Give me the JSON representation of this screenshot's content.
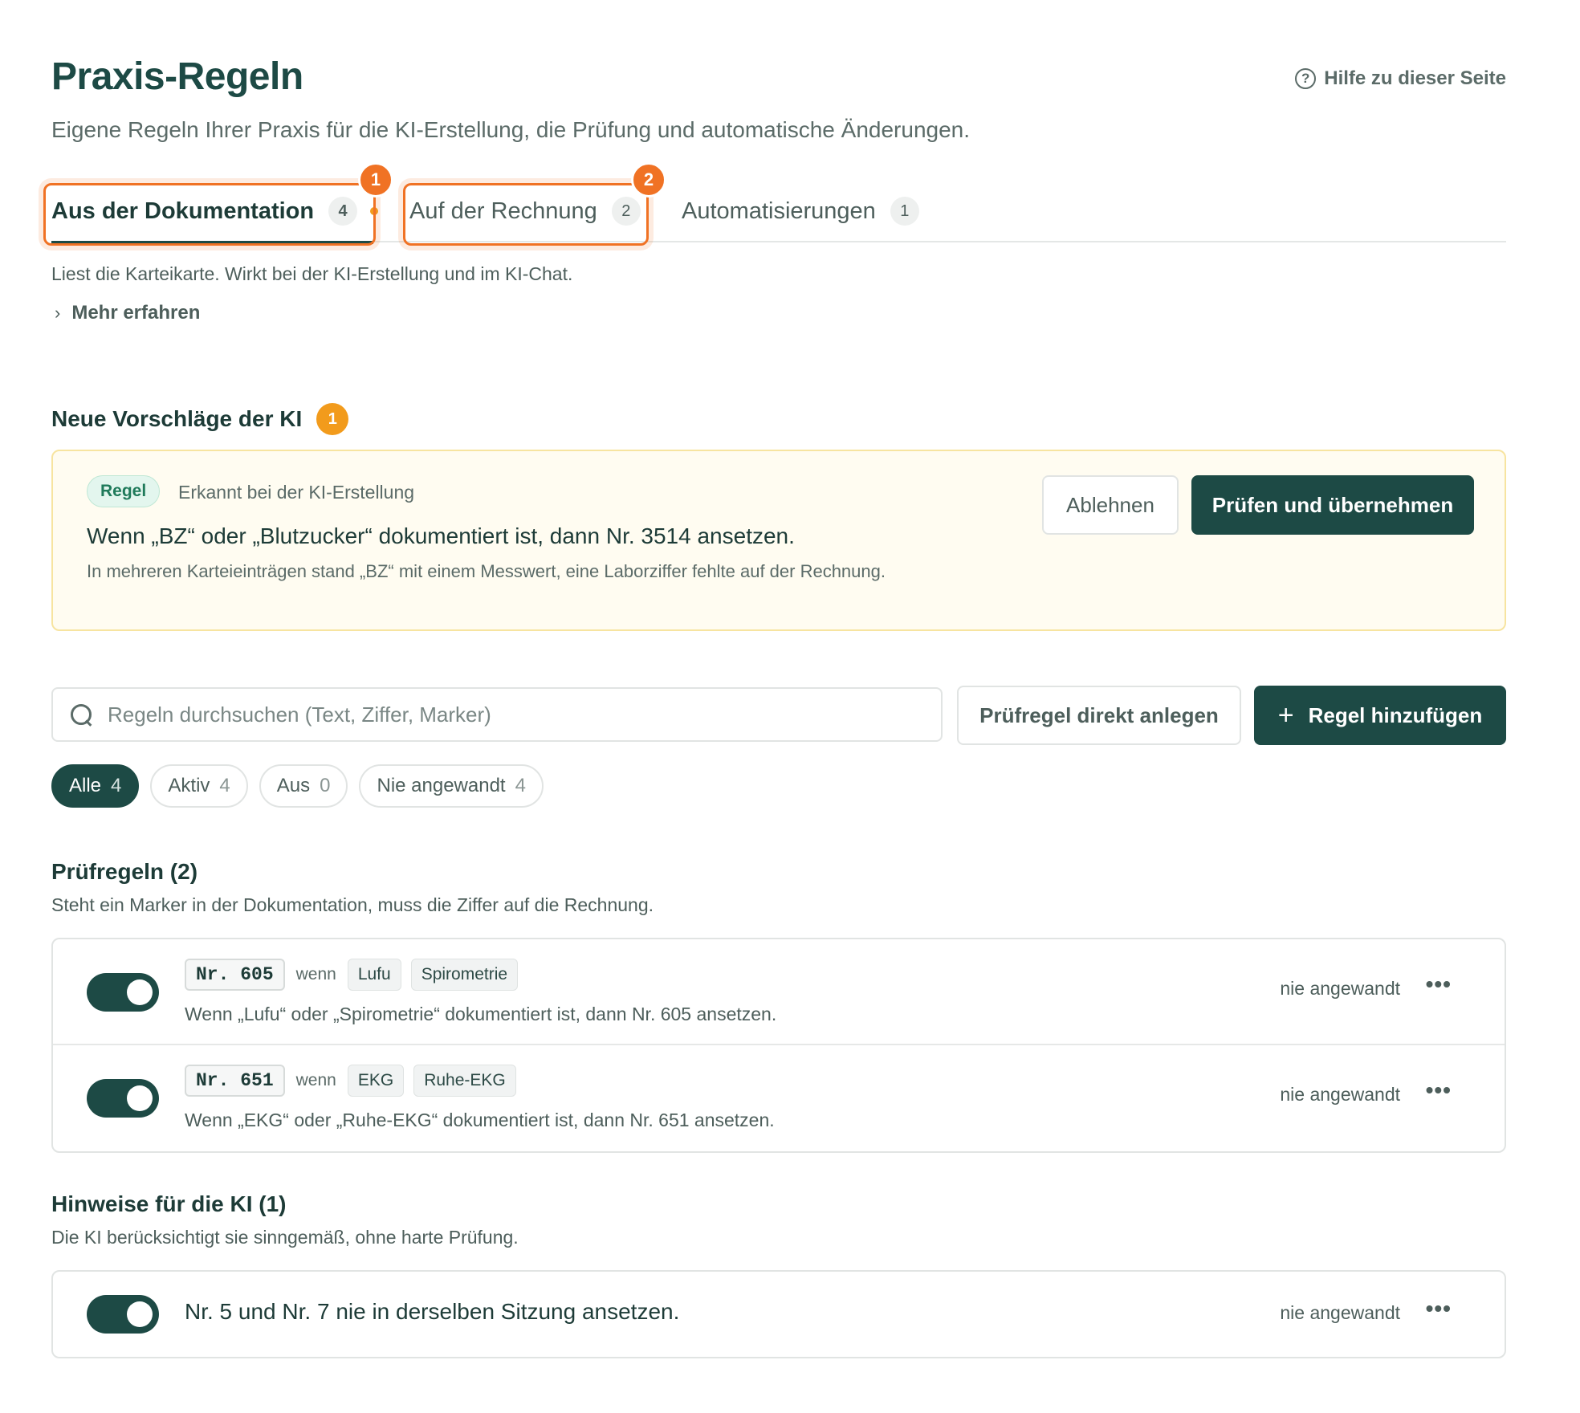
{
  "header": {
    "title": "Praxis-Regeln",
    "help_icon": "question-circle-icon",
    "help_label": "Hilfe zu dieser Seite",
    "subtitle": "Eigene Regeln Ihrer Praxis für die KI-Erstellung, die Prüfung und automatische Änderungen."
  },
  "tabs": [
    {
      "label": "Aus der Dokumentation",
      "count": "4",
      "active": true,
      "unsaved_dot": true,
      "marker": "1"
    },
    {
      "label": "Auf der Rechnung",
      "count": "2",
      "active": false,
      "marker": "2"
    },
    {
      "label": "Automatisierungen",
      "count": "1",
      "active": false
    }
  ],
  "tab_description": "Liest die Karteikarte. Wirkt bei der KI-Erstellung und im KI-Chat.",
  "more_link": {
    "icon": "chevron-right-icon",
    "label": "Mehr erfahren"
  },
  "suggestions": {
    "heading": "Neue Vorschläge der KI",
    "count": "1",
    "card": {
      "pill": "Regel",
      "source": "Erkannt bei der KI-Erstellung",
      "title": "Wenn „BZ“ oder „Blutzucker“ dokumentiert ist, dann Nr. 3514 ansetzen.",
      "description": "In mehreren Karteieinträgen stand „BZ“ mit einem Messwert, eine Laborziffer fehlte auf der Rechnung.",
      "reject_label": "Ablehnen",
      "accept_label": "Prüfen und übernehmen"
    }
  },
  "search": {
    "placeholder": "Regeln durchsuchen (Text, Ziffer, Marker)",
    "value": ""
  },
  "actions": {
    "direct_label": "Prüfregel direkt anlegen",
    "add_label": "Regel hinzufügen",
    "add_icon": "plus-icon"
  },
  "filters": [
    {
      "label": "Alle",
      "count": "4",
      "active": true
    },
    {
      "label": "Aktiv",
      "count": "4",
      "active": false
    },
    {
      "label": "Aus",
      "count": "0",
      "active": false
    },
    {
      "label": "Nie angewandt",
      "count": "4",
      "active": false
    }
  ],
  "pruefregeln": {
    "title": "Prüfregeln (2)",
    "description": "Steht ein Marker in der Dokumentation, muss die Ziffer auf die Rechnung.",
    "rules": [
      {
        "enabled": true,
        "code": "Nr. 605",
        "wenn": "wenn",
        "tags": [
          "Lufu",
          "Spirometrie"
        ],
        "text": "Wenn „Lufu“ oder „Spirometrie“ dokumentiert ist, dann Nr. 605 ansetzen.",
        "status": "nie angewandt",
        "menu": "•••"
      },
      {
        "enabled": true,
        "code": "Nr. 651",
        "wenn": "wenn",
        "tags": [
          "EKG",
          "Ruhe-EKG"
        ],
        "text": "Wenn „EKG“ oder „Ruhe-EKG“ dokumentiert ist, dann Nr. 651 ansetzen.",
        "status": "nie angewandt",
        "menu": "•••"
      }
    ]
  },
  "hinweise": {
    "title": "Hinweise für die KI (1)",
    "description": "Die KI berücksichtigt sie sinngemäß, ohne harte Prüfung.",
    "items": [
      {
        "enabled": true,
        "text": "Nr. 5 und Nr. 7 nie in derselben Sitzung ansetzen.",
        "status": "nie angewandt",
        "menu": "•••"
      }
    ]
  },
  "colors": {
    "primary": "#1d4a45",
    "highlight": "#f07224",
    "badge": "#f29b1c",
    "suggestion_bg": "#fffcf1"
  }
}
